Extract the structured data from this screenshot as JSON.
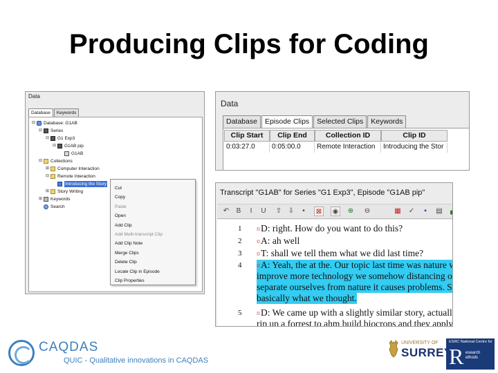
{
  "slide": {
    "title": "Producing Clips for Coding"
  },
  "left_panel": {
    "window_title": "Data",
    "tabs": [
      "Database",
      "Keywords"
    ],
    "tree": [
      {
        "label": "Database: G1AB",
        "depth": 0,
        "icon": "database-icon",
        "expander": "⊟"
      },
      {
        "label": "Series",
        "depth": 1,
        "icon": "series-icon",
        "expander": "⊟"
      },
      {
        "label": "G1 Exp3",
        "depth": 2,
        "icon": "series-icon",
        "expander": "⊟"
      },
      {
        "label": "G1AB pip",
        "depth": 3,
        "icon": "episode-icon",
        "expander": "⊟"
      },
      {
        "label": "G1AB",
        "depth": 4,
        "icon": "transcript-icon",
        "expander": ""
      },
      {
        "label": "Collections",
        "depth": 1,
        "icon": "folder-icon",
        "expander": "⊟"
      },
      {
        "label": "Computer Interaction",
        "depth": 2,
        "icon": "folder-icon",
        "expander": "⊞"
      },
      {
        "label": "Remote Interaction",
        "depth": 2,
        "icon": "folder-icon",
        "expander": "⊟"
      },
      {
        "label": "Introducing the Story",
        "depth": 3,
        "icon": "clip-icon",
        "expander": "",
        "selected": true
      },
      {
        "label": "Story Writing",
        "depth": 2,
        "icon": "folder-icon",
        "expander": "⊞"
      },
      {
        "label": "Keywords",
        "depth": 1,
        "icon": "keywords-icon",
        "expander": "⊞"
      },
      {
        "label": "Search",
        "depth": 1,
        "icon": "search-icon",
        "expander": ""
      }
    ],
    "context_menu": [
      {
        "label": "Cut",
        "disabled": false
      },
      {
        "label": "Copy",
        "disabled": false
      },
      {
        "label": "Paste",
        "disabled": true
      },
      {
        "label": "Open",
        "disabled": false
      },
      {
        "label": "Add Clip",
        "disabled": false
      },
      {
        "label": "Add Multi-transcript Clip",
        "disabled": true
      },
      {
        "label": "Add Clip Note",
        "disabled": false
      },
      {
        "label": "Merge Clips",
        "disabled": false
      },
      {
        "label": "Delete Clip",
        "disabled": false
      },
      {
        "label": "Locate Clip in Episode",
        "disabled": false
      },
      {
        "label": "Clip Properties",
        "disabled": false
      }
    ]
  },
  "episode_clips": {
    "window_title": "Data",
    "tabs": [
      "Database",
      "Episode Clips",
      "Selected Clips",
      "Keywords"
    ],
    "active_tab": 1,
    "columns": [
      "Clip Start",
      "Clip End",
      "Collection ID",
      "Clip ID"
    ],
    "rows": [
      [
        "0:03:27.0",
        "0:05:00.0",
        "Remote Interaction",
        "Introducing the Stor"
      ]
    ]
  },
  "transcript": {
    "window_title": "Transcript \"G1AB\" for Series \"G1 Exp3\", Episode \"G1AB pip\"",
    "toolbar_icons": [
      "undo-icon",
      "bold-icon",
      "italic-icon",
      "underline-icon",
      "up-arrow-icon",
      "down-arrow-icon",
      "circle-icon",
      "time-code-icon",
      "sound-icon",
      "zoom-in-icon",
      "zoom-out-icon",
      "image-icon",
      "spell-check-icon",
      "save-icon",
      "print-icon",
      "chart-icon"
    ],
    "lines": [
      {
        "num": "1",
        "text": "D: right. How do you want to do this?",
        "marker": true,
        "highlight": false
      },
      {
        "num": "2",
        "text": "A: ah well",
        "marker": true,
        "highlight": false
      },
      {
        "num": "3",
        "text": "T: shall we tell them what we did last time?",
        "marker": true,
        "highlight": false
      },
      {
        "num": "4",
        "text": "A: Yeah, the at the. Our topic last time was nature w",
        "marker": true,
        "highlight": true
      },
      {
        "num": "",
        "text": "improve more technology we somehow distancing our",
        "marker": false,
        "highlight": true
      },
      {
        "num": "",
        "text": "separate ourselves from nature it causes problems. So",
        "marker": false,
        "highlight": true
      },
      {
        "num": "",
        "text": "basically what we thought.",
        "marker": false,
        "highlight": true
      },
      {
        "num": "5",
        "text": "D: We came up with a slightly similar story, actually C",
        "marker": true,
        "highlight": false
      },
      {
        "num": "",
        "text": "rip up a forrest to ahm build biocrops and they apply t",
        "marker": false,
        "highlight": false
      }
    ]
  },
  "footer": {
    "caqdas_name": "CAQDAS",
    "caqdas_tagline": "QUIC - Qualitative innovations in CAQDAS",
    "surrey_univ": "UNIVERSITY OF",
    "surrey_name": "SURREY",
    "ncrm_top": "ESRC National Centre for",
    "ncrm_letter": "R",
    "ncrm_words": "esearch\nethods"
  },
  "colors": {
    "highlight": "#33ccf2",
    "selection": "#3d6fd1",
    "caqdas_blue": "#3c7fbf",
    "surrey_navy": "#1a2f6e",
    "ncrm_navy": "#1a3a78"
  }
}
